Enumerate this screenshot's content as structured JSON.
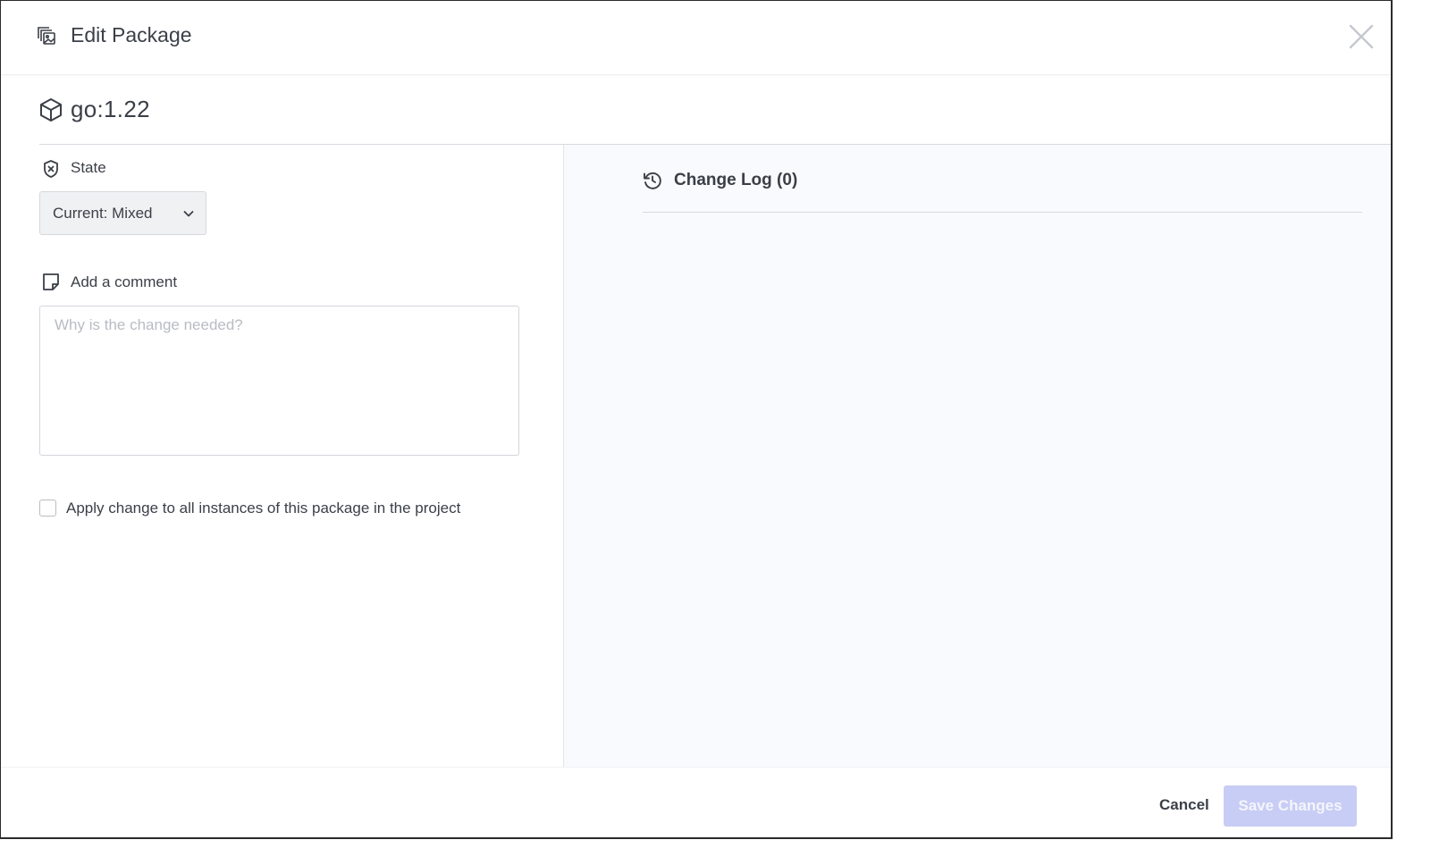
{
  "header": {
    "title": "Edit Package",
    "icon": "package-images-icon",
    "close_icon": "close-icon"
  },
  "package": {
    "name": "go:1.22",
    "icon": "cube-icon"
  },
  "state": {
    "label": "State",
    "icon": "shield-x-icon",
    "selected": "Current: Mixed"
  },
  "comment": {
    "label": "Add a comment",
    "icon": "note-icon",
    "value": "",
    "placeholder": "Why is the change needed?"
  },
  "apply_all": {
    "label": "Apply change to all instances of this package in the project",
    "checked": false
  },
  "changelog": {
    "title": "Change Log (0)",
    "icon": "history-icon"
  },
  "footer": {
    "cancel_label": "Cancel",
    "save_label": "Save Changes",
    "save_disabled": true
  },
  "colors": {
    "text": "#3b3f47",
    "placeholder": "#b9bcc3",
    "save_disabled_bg": "#c8cdf5",
    "right_pane_bg": "#f8fafd"
  }
}
